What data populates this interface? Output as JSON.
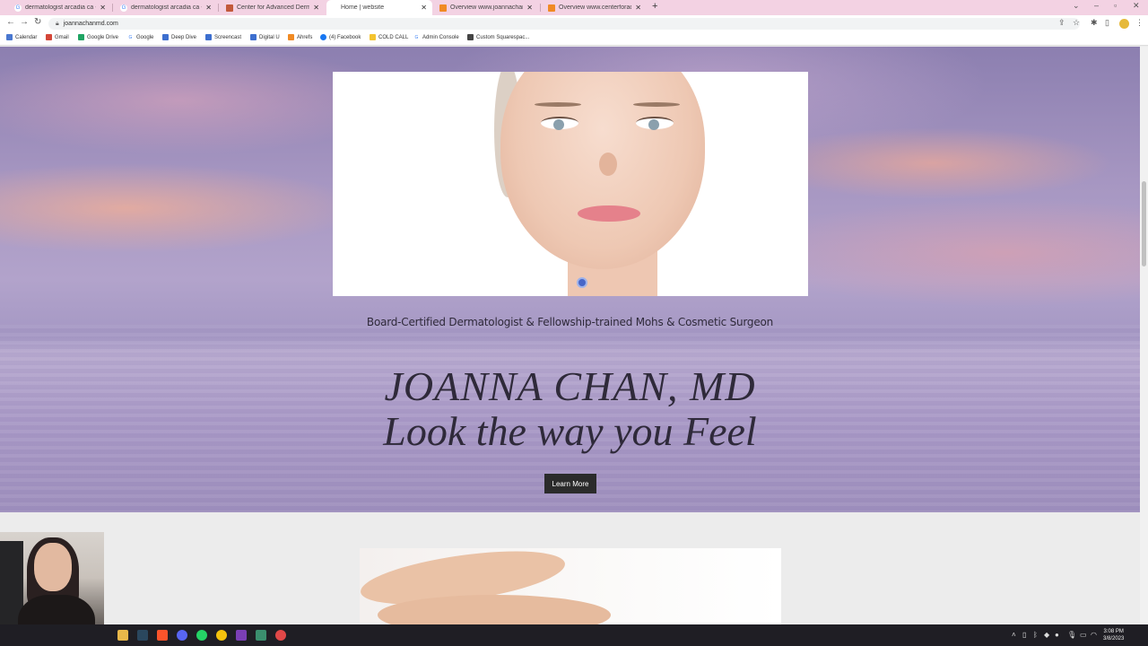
{
  "browser": {
    "tabs": [
      {
        "title": "dermatologist arcadia ca - Goog",
        "favicon": "google-icon"
      },
      {
        "title": "dermatologist arcadia ca - Googl",
        "favicon": "google-icon"
      },
      {
        "title": "Center for Advanced Dermatology",
        "favicon": "site-icon"
      },
      {
        "title": "Home | website",
        "favicon": "none",
        "active": true
      },
      {
        "title": "Overview www.joannachanmd.co",
        "favicon": "ahrefs-icon"
      },
      {
        "title": "Overview www.centerforadvance",
        "favicon": "ahrefs-icon"
      }
    ],
    "url": "joannachanmd.com",
    "bookmarks": [
      "Calendar",
      "Gmail",
      "Google Drive",
      "Google",
      "Deep Dive",
      "Screencast",
      "Digital U",
      "Ahrefs",
      "(4) Facebook",
      "COLD CALL",
      "Admin Console",
      "Custom Squarespac..."
    ]
  },
  "hero": {
    "tagline": "Board-Certified Dermatologist & Fellowship-trained Mohs & Cosmetic Surgeon",
    "name": "JOANNA CHAN, MD",
    "slogan": "Look the way you Feel",
    "cta": "Learn More"
  },
  "taskbar": {
    "time": "3:08 PM",
    "date": "3/8/2023"
  },
  "colors": {
    "tabbar": "#f3d2e3",
    "hero_purple": "#a797c2",
    "button": "#2b2b2b",
    "text": "#2f2a3a"
  }
}
